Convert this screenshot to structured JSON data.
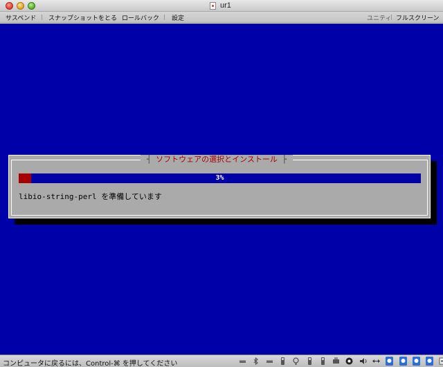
{
  "window": {
    "title": "ur1"
  },
  "toolbar": {
    "items": [
      "サスペンド",
      "スナップショットをとる",
      "ロールバック",
      "設定"
    ],
    "right_items": [
      "ユニティ",
      "フルスクリーン"
    ]
  },
  "installer": {
    "dialog_title": "ソフトウェアの選択とインストール",
    "progress_percent": 3,
    "progress_label": "3%",
    "status": "libio-string-perl を準備しています"
  },
  "statusbar": {
    "hint": "コンピュータに戻るには、Control-⌘ を押してください",
    "device_icons": [
      "hard-disk-icon",
      "bluetooth-icon",
      "hard-disk-icon",
      "usb-drive-icon",
      "webcam-icon",
      "usb-drive-icon",
      "usb-drive-icon",
      "printer-icon",
      "camera-icon",
      "speaker-icon",
      "network-icon",
      "usb-device-icon",
      "usb-device-icon",
      "usb-device-icon",
      "usb-device-icon",
      "keyboard-icon"
    ]
  },
  "colors": {
    "screen_bg": "#0000a8",
    "dialog_bg": "#aaaaaa",
    "progress_fill": "#a80000",
    "title_red": "#a80000"
  }
}
